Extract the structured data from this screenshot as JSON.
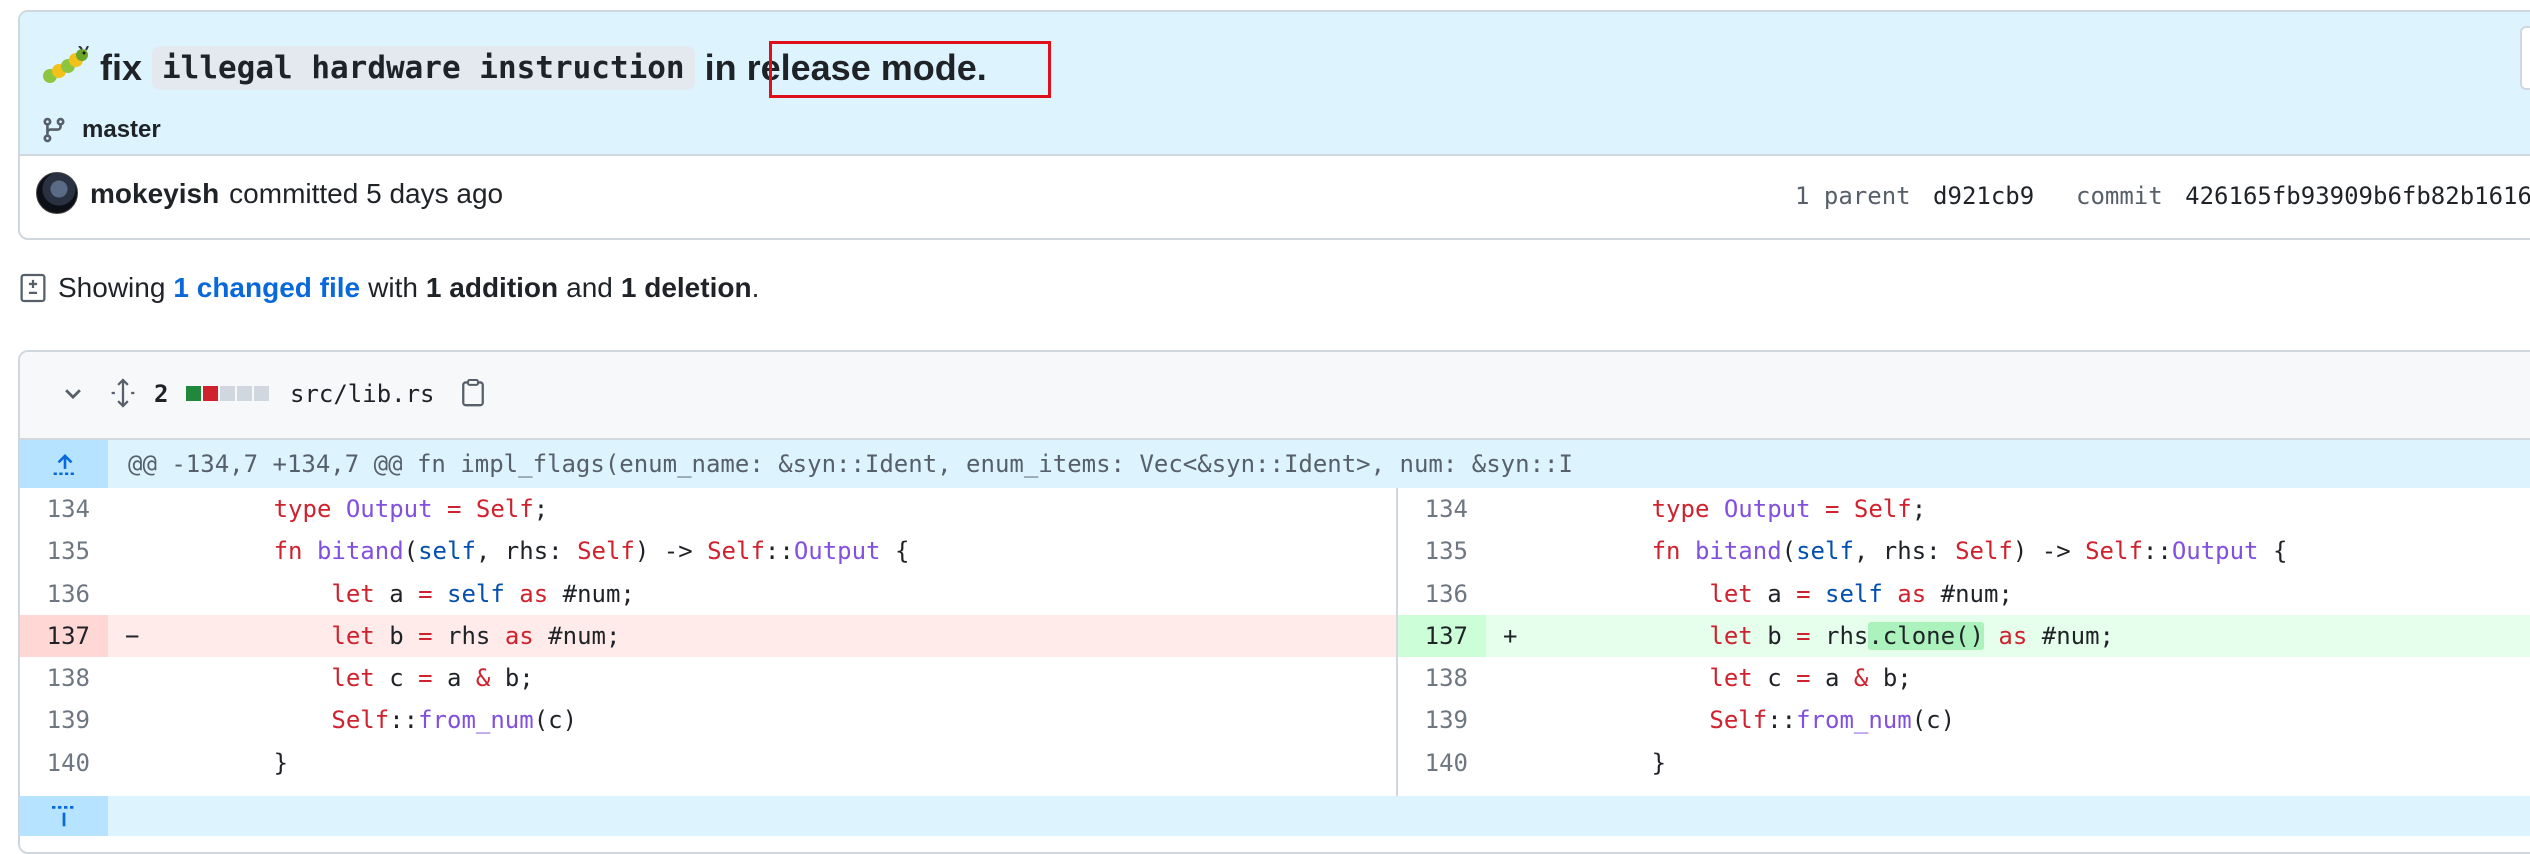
{
  "commit": {
    "title_prefix": "fix",
    "title_code": "illegal hardware instruction",
    "title_in": "in",
    "title_suffix": "release mode.",
    "branch": "master",
    "author": "mokeyish",
    "committed": "committed 5 days ago",
    "parent_label": "1 parent",
    "parent_sha": "d921cb9",
    "commit_label": "commit",
    "commit_sha": "426165fb93909b6fb82b1616"
  },
  "summary": {
    "showing": "Showing",
    "changed_files": "1 changed file",
    "with": "with",
    "additions": "1 addition",
    "and": "and",
    "deletions": "1 deletion",
    "period": "."
  },
  "file": {
    "change_count": "2",
    "filename": "src/lib.rs",
    "hunk_header": "@@ -134,7 +134,7 @@ fn impl_flags(enum_name: &syn::Ident, enum_items: Vec<&syn::Ident>, num: &syn::I",
    "left_lines": [
      {
        "num": "134",
        "sign": "",
        "code": "        type Output = Self;"
      },
      {
        "num": "135",
        "sign": "",
        "code": "        fn bitand(self, rhs: Self) -> Self::Output {"
      },
      {
        "num": "136",
        "sign": "",
        "code": "            let a = self as #num;"
      },
      {
        "num": "137",
        "sign": "−",
        "code": "            let b = rhs as #num;"
      },
      {
        "num": "138",
        "sign": "",
        "code": "            let c = a & b;"
      },
      {
        "num": "139",
        "sign": "",
        "code": "            Self::from_num(c)"
      },
      {
        "num": "140",
        "sign": "",
        "code": "        }"
      }
    ],
    "right_lines": [
      {
        "num": "134",
        "sign": "",
        "code": "        type Output = Self;"
      },
      {
        "num": "135",
        "sign": "",
        "code": "        fn bitand(self, rhs: Self) -> Self::Output {"
      },
      {
        "num": "136",
        "sign": "",
        "code": "            let a = self as #num;"
      },
      {
        "num": "137",
        "sign": "+",
        "code": "            let b = rhs.clone() as #num;"
      },
      {
        "num": "138",
        "sign": "",
        "code": "            let c = a & b;"
      },
      {
        "num": "139",
        "sign": "",
        "code": "            Self::from_num(c)"
      },
      {
        "num": "140",
        "sign": "",
        "code": "        }"
      }
    ]
  },
  "colors": {
    "header_bg": "#ddf4ff",
    "deletion_bg": "#ffebe9",
    "addition_bg": "#e6ffec",
    "link": "#0969da",
    "highlight_border": "#e0101b"
  }
}
